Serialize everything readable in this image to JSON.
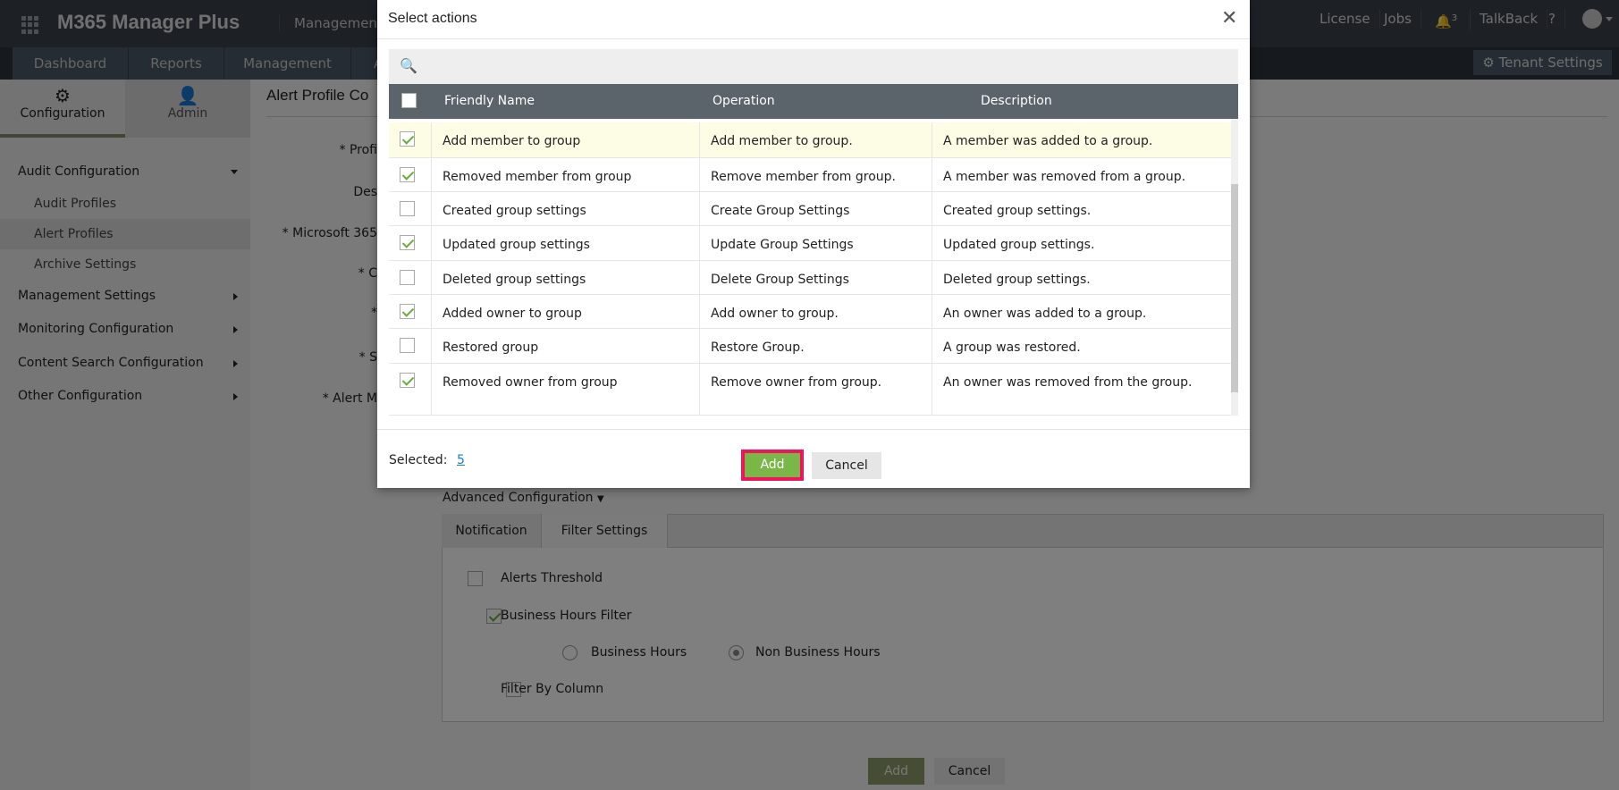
{
  "header": {
    "app_title": "M365 Manager Plus",
    "product_sub": "Management & R",
    "links": [
      "License",
      "Jobs",
      "TalkBack",
      "?"
    ],
    "notification_count": "3",
    "tenant_settings": "Tenant Settings"
  },
  "nav": {
    "tabs": [
      "Dashboard",
      "Reports",
      "Management",
      "A"
    ]
  },
  "sidebar": {
    "tabs": [
      "Configuration",
      "Admin"
    ],
    "items": [
      {
        "label": "Audit Configuration",
        "expanded": true
      },
      {
        "label": "Audit Profiles"
      },
      {
        "label": "Alert Profiles",
        "selected": true
      },
      {
        "label": "Archive Settings"
      },
      {
        "label": "Management Settings"
      },
      {
        "label": "Monitoring Configuration"
      },
      {
        "label": "Content Search Configuration"
      },
      {
        "label": "Other Configuration"
      }
    ]
  },
  "main": {
    "title": "Alert Profile Co",
    "form_labels": [
      "Profi",
      "Des",
      "Microsoft 365",
      "C",
      "",
      "S",
      "Alert M"
    ],
    "required": [
      true,
      false,
      true,
      true,
      true,
      true,
      true
    ],
    "advanced_config": "Advanced Configuration",
    "tabs": [
      "Notification",
      "Filter Settings"
    ],
    "filters": {
      "alerts_threshold": {
        "label": "Alerts Threshold",
        "checked": false
      },
      "business_hours_filter": {
        "label": "Business Hours Filter",
        "checked": true
      },
      "business_hours": "Business Hours",
      "non_business_hours": "Non Business Hours",
      "selected_radio": "Non Business Hours",
      "filter_by_column": {
        "label": "Filter By Column",
        "checked": false
      }
    },
    "add": "Add",
    "cancel": "Cancel"
  },
  "modal": {
    "title": "Select actions",
    "columns": [
      "Friendly Name",
      "Operation",
      "Description"
    ],
    "rows": [
      {
        "checked": true,
        "name": "Add member to group",
        "operation": "Add member to group.",
        "description": "A member was added to a group."
      },
      {
        "checked": true,
        "name": "Removed member from group",
        "operation": "Remove member from group.",
        "description": "A member was removed from a group."
      },
      {
        "checked": false,
        "name": "Created group settings",
        "operation": "Create Group Settings",
        "description": "Created group settings."
      },
      {
        "checked": true,
        "name": "Updated group settings",
        "operation": "Update Group Settings",
        "description": "Updated group settings."
      },
      {
        "checked": false,
        "name": "Deleted group settings",
        "operation": "Delete Group Settings",
        "description": "Deleted group settings."
      },
      {
        "checked": true,
        "name": "Added owner to group",
        "operation": "Add owner to group.",
        "description": "An owner was added to a group."
      },
      {
        "checked": false,
        "name": "Restored group",
        "operation": "Restore Group.",
        "description": "A group was restored."
      },
      {
        "checked": true,
        "name": "Removed owner from group",
        "operation": "Remove owner from group.",
        "description": "An owner was removed from the group."
      }
    ],
    "selected_label": "Selected:",
    "selected_count": "5",
    "add": "Add",
    "cancel": "Cancel"
  },
  "colors": {
    "accent_green": "#7ab648",
    "highlight_border": "#f0145a",
    "table_header": "#5b636b",
    "row_highlight": "#fdfde6"
  }
}
